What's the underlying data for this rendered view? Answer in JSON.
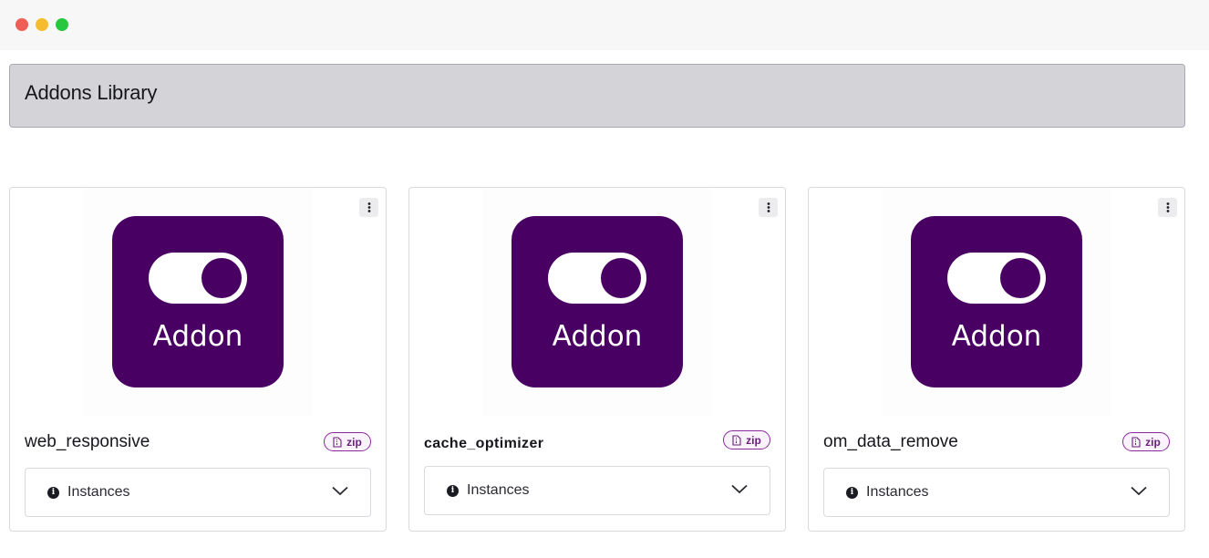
{
  "page": {
    "title": "Addons Library"
  },
  "brand": {
    "color": "#480062",
    "badge_color": "#6b1d7e"
  },
  "addons": [
    {
      "name": "web_responsive",
      "logo_text": "Addon",
      "badge": "zip",
      "instances_label": "Instances"
    },
    {
      "name": "cache_optimizer",
      "logo_text": "Addon",
      "badge": "zip",
      "instances_label": "Instances"
    },
    {
      "name": "om_data_remove",
      "logo_text": "Addon",
      "badge": "zip",
      "instances_label": "Instances"
    }
  ],
  "icons": {
    "menu": "kebab-menu-icon",
    "badge": "file-archive-icon",
    "info": "info-circle-icon",
    "expand": "chevron-down-icon"
  }
}
